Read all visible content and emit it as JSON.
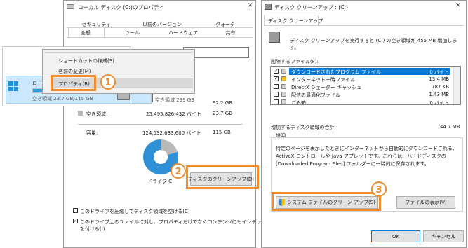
{
  "props": {
    "title": "ローカル ディスク (C:)のプロパティ",
    "tabs_row1": [
      "セキュリティ",
      "以前のバージョン",
      "クォータ"
    ],
    "tabs_row2": [
      "全般",
      "ツール",
      "ハードウェア",
      "共有"
    ],
    "used_label": "空き領域 23.7 GB/115 GB",
    "drive2_label": "空き領域 299 GB",
    "size_col1": "92.2 GB",
    "free_label": "空き領域:",
    "free_bytes": "25,495,826,432 バイト",
    "free_gb": "23.7 GB",
    "capacity_label": "容量:",
    "capacity_bytes": "124,532,633,600 バイト",
    "capacity_gb": "115 GB",
    "drive_label": "ドライブ C",
    "cleanup_button": "ディスクのクリーンアップ(D)",
    "compress_check": "このドライブを圧縮してディスク領域を空ける(C)",
    "index_check_line1": "このドライブ上のファイルに対し、プロパティだけでなくコンテンツにもインデックス",
    "index_check_line2": "を付ける(I)",
    "used_color": "#2f90d6",
    "free_color": "#b9b9b9"
  },
  "context_menu": {
    "drive_name": "ロー",
    "items": [
      "ショートカットの作成(S)",
      "名前の変更(M)",
      "プロパティ(R)"
    ]
  },
  "cleanup": {
    "title": "ディスク クリーンアップ : (C:)",
    "tab": "ディスク クリーンアップ",
    "description": "ディスク クリーンアップを実行すると (C:) の空き領域が 455 MB 増加しま す。",
    "files_label": "削除するファイル(F):",
    "files": [
      {
        "name": "ダウンロードされたプログラム ファイル",
        "size": "0 バイト",
        "checked": true,
        "selected": true
      },
      {
        "name": "インターネット一時ファイル",
        "size": "13.4 MB",
        "checked": true,
        "selected": false
      },
      {
        "name": "DirectX シェーダー キャッシュ",
        "size": "787 KB",
        "checked": false,
        "selected": false
      },
      {
        "name": "配信の最適化ファイル",
        "size": "1.43 MB",
        "checked": false,
        "selected": false
      },
      {
        "name": "ごみ箱",
        "size": "0 バイト",
        "checked": false,
        "selected": false
      }
    ],
    "total_label": "増加するディスク領域の合計:",
    "total_value": "44.7 MB",
    "explain_label": "説明",
    "explain_line1": "特定のページを表示したときにインターネットから自動的にダウンロードされる、",
    "explain_line2": "ActiveX コントロールや Java アプレットです。これらは、ハードディスクの",
    "explain_line3": "[Downloaded Program Files] フォルダーに一時的に保存されます。",
    "system_button": "システム ファイルのクリーン アップ(S)",
    "view_files_button": "ファイルの表示(V)",
    "ok": "OK",
    "cancel": "キャンセル"
  },
  "markers": [
    "1",
    "2",
    "3"
  ],
  "accent_color": "#f08c2e"
}
